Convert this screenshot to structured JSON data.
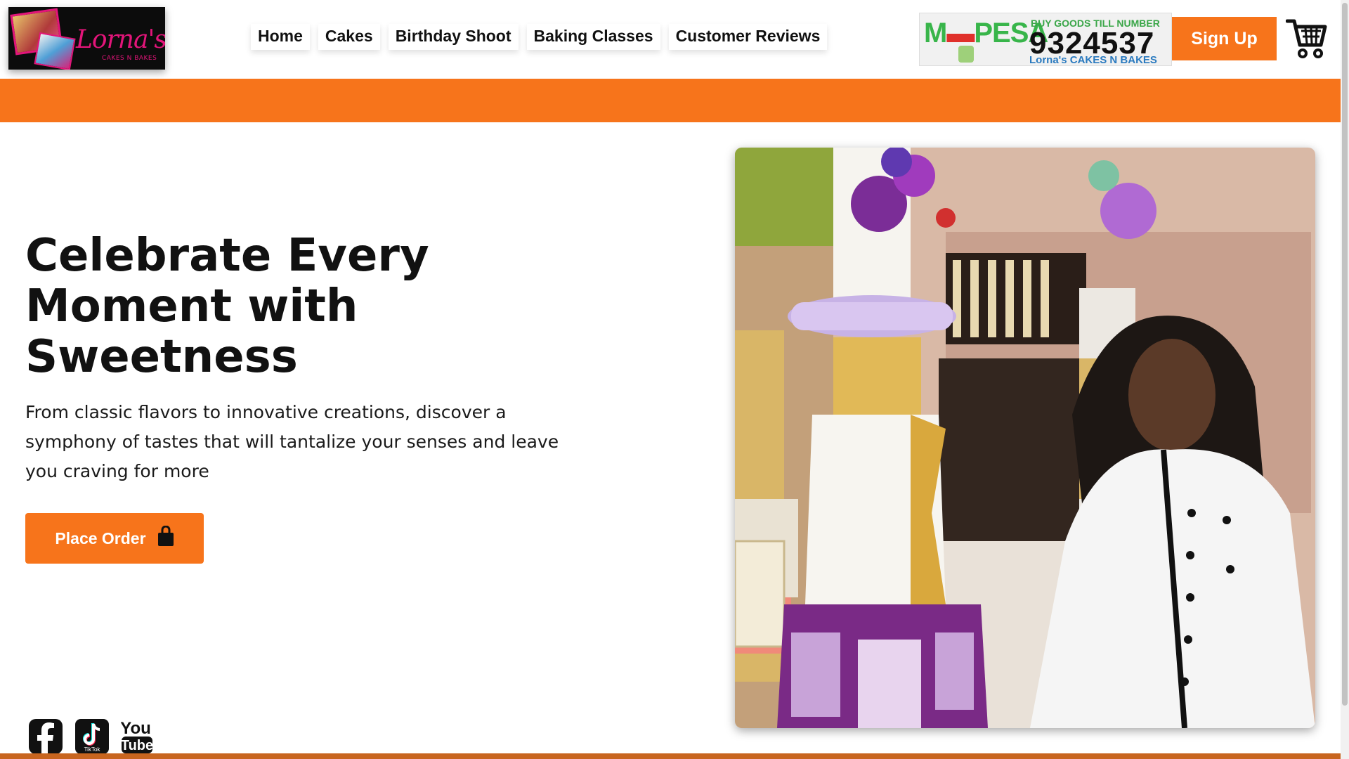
{
  "brand": {
    "name": "Lorna's",
    "tagline": "CAKES N BAKES"
  },
  "nav": {
    "items": [
      {
        "label": "Home"
      },
      {
        "label": "Cakes"
      },
      {
        "label": "Birthday Shoot"
      },
      {
        "label": "Baking Classes"
      },
      {
        "label": "Customer Reviews"
      }
    ]
  },
  "mpesa": {
    "logo_left": "M",
    "logo_right": "PESA",
    "buy_goods": "BUY GOODS TILL NUMBER",
    "till_number": "9324537",
    "business": "Lorna's CAKES N BAKES"
  },
  "header": {
    "signup_label": "Sign Up",
    "cart_icon": "shopping-cart-icon"
  },
  "hero": {
    "title": "Celebrate Every Moment with Sweetness",
    "text": "From classic flavors to innovative creations, discover a symphony of tastes that will tantalize your senses and leave you craving for more",
    "order_label": "Place Order",
    "order_icon": "shopping-bag-icon"
  },
  "social": [
    {
      "icon": "facebook-icon"
    },
    {
      "icon": "tiktok-icon",
      "label": "TikTok"
    },
    {
      "icon": "youtube-icon",
      "label_top": "You",
      "label_bottom": "Tube"
    }
  ],
  "colors": {
    "accent": "#f7741b",
    "brand_pink": "#e3157a",
    "mpesa_green": "#38b54a"
  }
}
